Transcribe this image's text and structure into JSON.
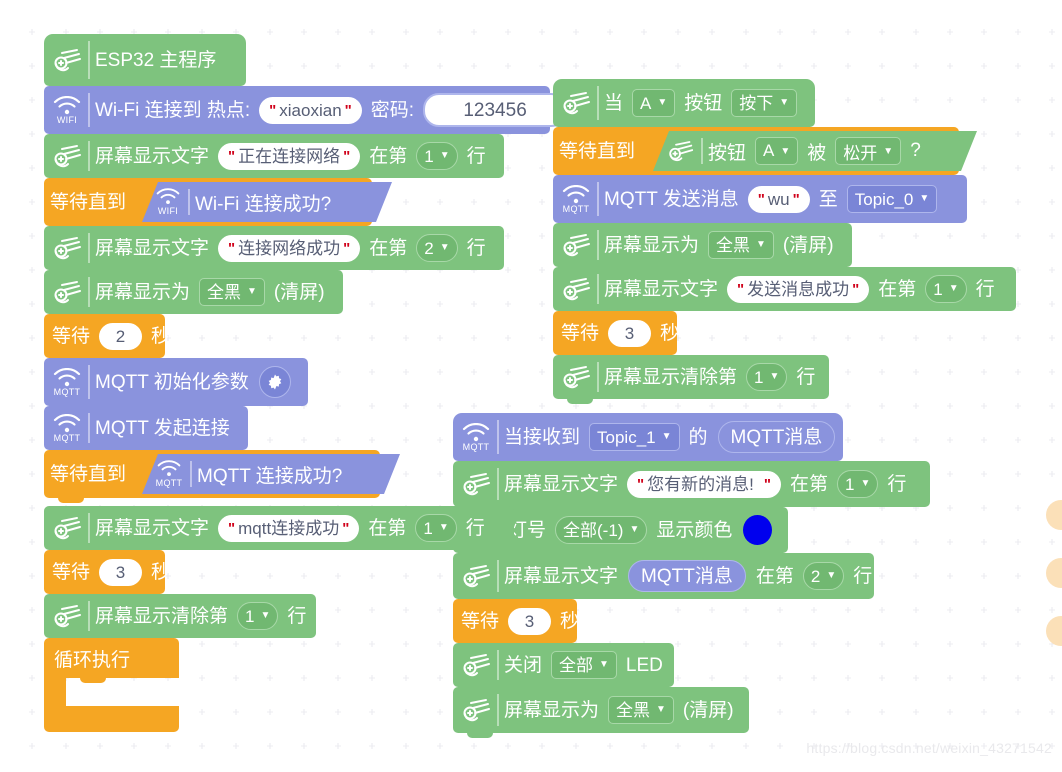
{
  "app": {
    "type": "block-based-visual-programming-canvas",
    "watermark": "https://blog.csdn.net/weixin_43271542",
    "colors": {
      "green": "#7ec37e",
      "purple": "#8a93dd",
      "orange": "#f5a623",
      "canvas": "#ffffff",
      "led_color_swatch": "#0000ee"
    }
  },
  "scripts": {
    "main": {
      "name": "esp32-main-program-script",
      "blocks": [
        {
          "id": "hat",
          "icon": "esp32-board-icon",
          "text": "ESP32 主程序"
        },
        {
          "id": "wifi_connect",
          "icon": "wifi-icon",
          "icon_label": "WIFI",
          "t1": "Wi-Fi 连接到 热点:",
          "field1": "xiaoxian",
          "t2": "密码:",
          "field2": "123456"
        },
        {
          "id": "show_text_1",
          "icon": "esp32-board-icon",
          "t1": "屏幕显示文字",
          "field1": "正在连接网络",
          "t2": "在第",
          "dd1": "1",
          "t3": "行"
        },
        {
          "id": "wait_until_wifi",
          "t1": "等待直到",
          "cond_icon": "wifi-icon",
          "cond_icon_label": "WIFI",
          "cond": "Wi-Fi 连接成功?"
        },
        {
          "id": "show_text_2",
          "icon": "esp32-board-icon",
          "t1": "屏幕显示文字",
          "field1": "连接网络成功",
          "t2": "在第",
          "dd1": "2",
          "t3": "行"
        },
        {
          "id": "screen_clear_1",
          "icon": "esp32-board-icon",
          "t1": "屏幕显示为",
          "dd1": "全黑",
          "t2": "(清屏)"
        },
        {
          "id": "wait_2",
          "t1": "等待",
          "num": "2",
          "t2": "秒"
        },
        {
          "id": "mqtt_init",
          "icon": "mqtt-icon",
          "icon_label": "MQTT",
          "t1": "MQTT 初始化参数",
          "button": "gear-icon"
        },
        {
          "id": "mqtt_connect",
          "icon": "mqtt-icon",
          "icon_label": "MQTT",
          "t1": "MQTT 发起连接"
        },
        {
          "id": "wait_until_mqtt",
          "t1": "等待直到",
          "cond_icon": "mqtt-icon",
          "cond_icon_label": "MQTT",
          "cond": "MQTT 连接成功?"
        },
        {
          "id": "show_text_3",
          "icon": "esp32-board-icon",
          "t1": "屏幕显示文字",
          "field1": "mqtt连接成功",
          "t2": "在第",
          "dd1": "1",
          "t3": "行"
        },
        {
          "id": "wait_3a",
          "t1": "等待",
          "num": "3",
          "t2": "秒"
        },
        {
          "id": "screen_clearline_1",
          "icon": "esp32-board-icon",
          "t1": "屏幕显示清除第",
          "dd1": "1",
          "t2": "行"
        },
        {
          "id": "forever",
          "t1": "循环执行"
        }
      ]
    },
    "button_a": {
      "name": "on-button-a-pressed-script",
      "blocks": [
        {
          "id": "hat_btn",
          "icon": "esp32-board-icon",
          "t1": "当",
          "dd1": "A",
          "t2": "按钮",
          "dd2": "按下"
        },
        {
          "id": "wait_until_btn",
          "t1": "等待直到",
          "cond_icon": "esp32-board-icon",
          "cond_t1": "按钮",
          "cond_dd1": "A",
          "cond_t2": "被",
          "cond_dd2": "松开",
          "cond_t3": "?"
        },
        {
          "id": "mqtt_send",
          "icon": "mqtt-icon",
          "icon_label": "MQTT",
          "t1": "MQTT 发送消息",
          "field1": "wu",
          "t2": "至",
          "dd1": "Topic_0"
        },
        {
          "id": "screen_clear_b",
          "icon": "esp32-board-icon",
          "t1": "屏幕显示为",
          "dd1": "全黑",
          "t2": "(清屏)"
        },
        {
          "id": "show_text_b1",
          "icon": "esp32-board-icon",
          "t1": "屏幕显示文字",
          "field1": "发送消息成功",
          "t2": "在第",
          "dd1": "1",
          "t3": "行"
        },
        {
          "id": "wait_3b",
          "t1": "等待",
          "num": "3",
          "t2": "秒"
        },
        {
          "id": "clearline_b",
          "icon": "esp32-board-icon",
          "t1": "屏幕显示清除第",
          "dd1": "1",
          "t2": "行"
        }
      ]
    },
    "mqtt_receive": {
      "name": "on-mqtt-message-received-script",
      "blocks": [
        {
          "id": "hat_mqtt",
          "icon": "mqtt-icon",
          "icon_label": "MQTT",
          "t1": "当接收到",
          "dd1": "Topic_1",
          "t2": "的",
          "reporter": "MQTT消息"
        },
        {
          "id": "show_text_m1",
          "icon": "esp32-board-icon",
          "t1": "屏幕显示文字",
          "field1": "您有新的消息!",
          "t2": "在第",
          "dd1": "1",
          "t3": "行"
        },
        {
          "id": "led_show",
          "t1": "灯号",
          "dd1": "全部(-1)",
          "t2": "显示颜色",
          "color": "#0000ee"
        },
        {
          "id": "show_text_m2",
          "icon": "esp32-board-icon",
          "t1": "屏幕显示文字",
          "reporter": "MQTT消息",
          "t2": "在第",
          "dd1": "2",
          "t3": "行"
        },
        {
          "id": "wait_3c",
          "t1": "等待",
          "num": "3",
          "t2": "秒"
        },
        {
          "id": "led_off",
          "icon": "esp32-board-icon",
          "t1": "关闭",
          "dd1": "全部",
          "t2": "LED"
        },
        {
          "id": "screen_clear_m",
          "icon": "esp32-board-icon",
          "t1": "屏幕显示为",
          "dd1": "全黑",
          "t2": "(清屏)"
        }
      ]
    }
  }
}
